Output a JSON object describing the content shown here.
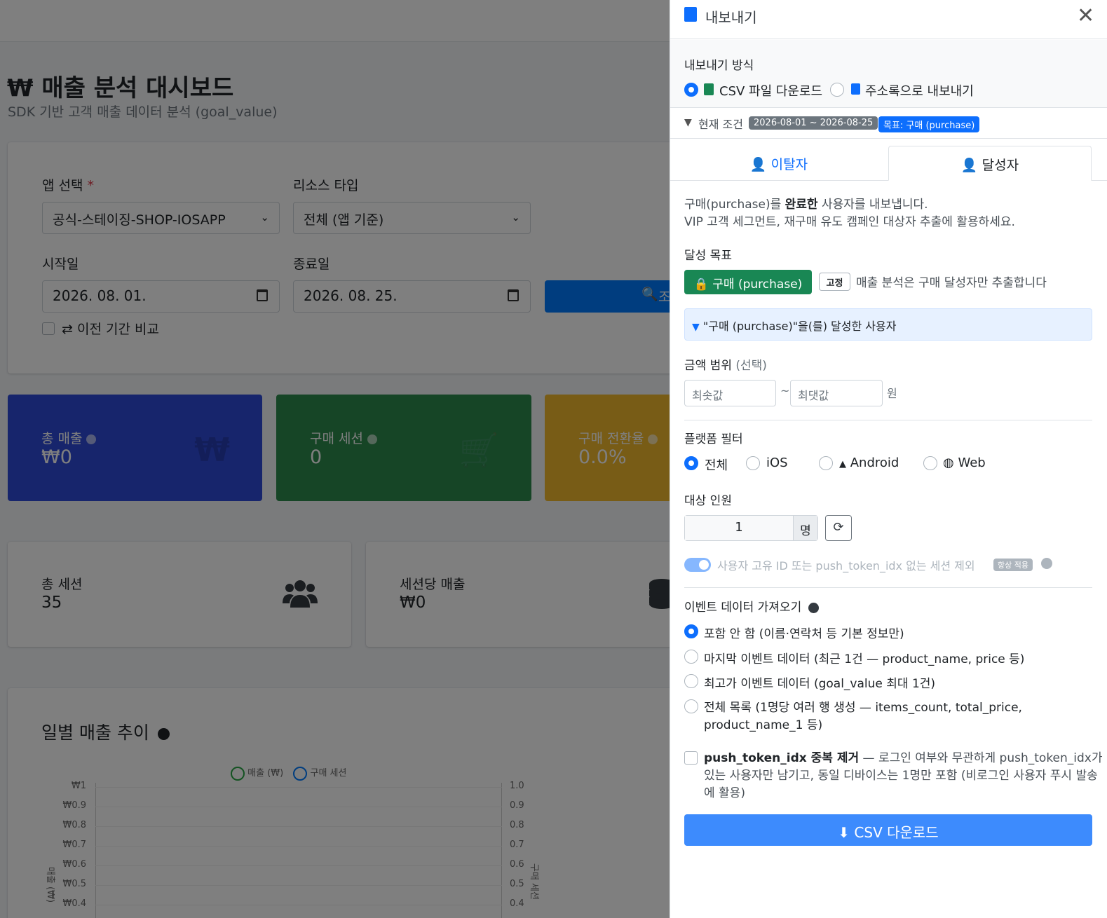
{
  "dashboard": {
    "title": "₩ 매출 분석 대시보드",
    "subtitle": "SDK 기반 고객 매출 데이터 분석 (goal_value)",
    "filters": {
      "app_label": "앱 선택",
      "required_mark": "*",
      "app_value": "공식-스테이징-SHOP-IOSAPP",
      "resource_label": "리소스 타입",
      "resource_value": "전체 (앱 기준)",
      "start_label": "시작일",
      "start_value": "2026. 08. 01.",
      "end_label": "종료일",
      "end_value": "2026. 08. 25.",
      "search_label": "조",
      "compare_label": "⇄ 이전 기간 비교"
    },
    "kpis": [
      {
        "title": "총 매출",
        "value": "₩0",
        "icon": "₩",
        "color": "#2f4bd9"
      },
      {
        "title": "구매 세션",
        "value": "0",
        "icon": "🛒",
        "color": "#2c8a4c"
      },
      {
        "title": "구매 전환율",
        "value": "0.0%",
        "icon": "",
        "color": "#f0b92c"
      }
    ],
    "stats": [
      {
        "title": "총 세션",
        "value": "35",
        "icon": "users-icon"
      },
      {
        "title": "세션당 매출",
        "value": "₩0",
        "icon": "coins-icon"
      }
    ],
    "chart": {
      "title": "일별 매출 추이",
      "legend": [
        "매출 (₩)",
        "구매 세션"
      ],
      "left_ticks": [
        "₩1",
        "₩0.9",
        "₩0.8",
        "₩0.7",
        "₩0.6",
        "₩0.5",
        "₩0.4"
      ],
      "right_ticks": [
        "1.0",
        "0.9",
        "0.8",
        "0.7",
        "0.6",
        "0.5",
        "0.4"
      ],
      "ylabel_left": "매출 (₩)",
      "ylabel_right": "구매 세션"
    }
  },
  "export_panel": {
    "title": "내보내기",
    "method_label": "내보내기 방식",
    "methods": [
      {
        "label": "CSV 파일 다운로드",
        "selected": true
      },
      {
        "label": "주소록으로 내보내기",
        "selected": false
      }
    ],
    "condition_label": "현재 조건",
    "condition_date": "2026-08-01 ~ 2026-08-25",
    "condition_goal": "목표: 구매 (purchase)",
    "tabs": [
      {
        "label": "이탈자",
        "active": false
      },
      {
        "label": "달성자",
        "active": true
      }
    ],
    "desc_prefix": "구매(purchase)를 ",
    "desc_bold": "완료한",
    "desc_suffix": " 사용자를 내보냅니다.",
    "desc_line2": "VIP 고객 세그먼트, 재구매 유도 캠페인 대상자 추출에 활용하세요.",
    "goal_label": "달성 목표",
    "goal_button": "구매 (purchase)",
    "fixed_badge": "고정",
    "goal_note": "매출 분석은 구매 달성자만 추출합니다",
    "goal_filter_text": "\"구매 (purchase)\"을(를) 달성한 사용자",
    "amount_label": "금액 범위",
    "amount_optional": "(선택)",
    "amount_min_placeholder": "최솟값",
    "amount_tilde": "~",
    "amount_max_placeholder": "최댓값",
    "amount_unit": "원",
    "platform_label": "플랫폼 필터",
    "platforms": [
      {
        "label": "전체",
        "selected": true
      },
      {
        "label": "iOS",
        "selected": false
      },
      {
        "label": "Android",
        "selected": false
      },
      {
        "label": "Web",
        "selected": false
      }
    ],
    "target_label": "대상 인원",
    "target_count": "1",
    "target_unit": "명",
    "exclude_label": "사용자 고유 ID 또는 push_token_idx 없는 세션 제외",
    "always_badge": "항상 적용",
    "event_label": "이벤트 데이터 가져오기",
    "event_options": [
      {
        "label": "포함 안 함 (이름·연락처 등 기본 정보만)",
        "selected": true
      },
      {
        "label": "마지막 이벤트 데이터 (최근 1건 — product_name, price 등)",
        "selected": false
      },
      {
        "label": "최고가 이벤트 데이터 (goal_value 최대 1건)",
        "selected": false
      },
      {
        "label": "전체 목록 (1명당 여러 행 생성 — items_count, total_price,",
        "label2": "product_name_1 등)",
        "selected": false
      }
    ],
    "dedup_bold": "push_token_idx 중복 제거",
    "dedup_line1": " — 로그인 여부와 무관하게 push_token_idx가",
    "dedup_line2": "있는 사용자만 남기고, 동일 디바이스는 1명만 포함 (비로그인 사용자 푸시 발송",
    "dedup_line3": "에 활용)",
    "download_button": "CSV 다운로드"
  }
}
